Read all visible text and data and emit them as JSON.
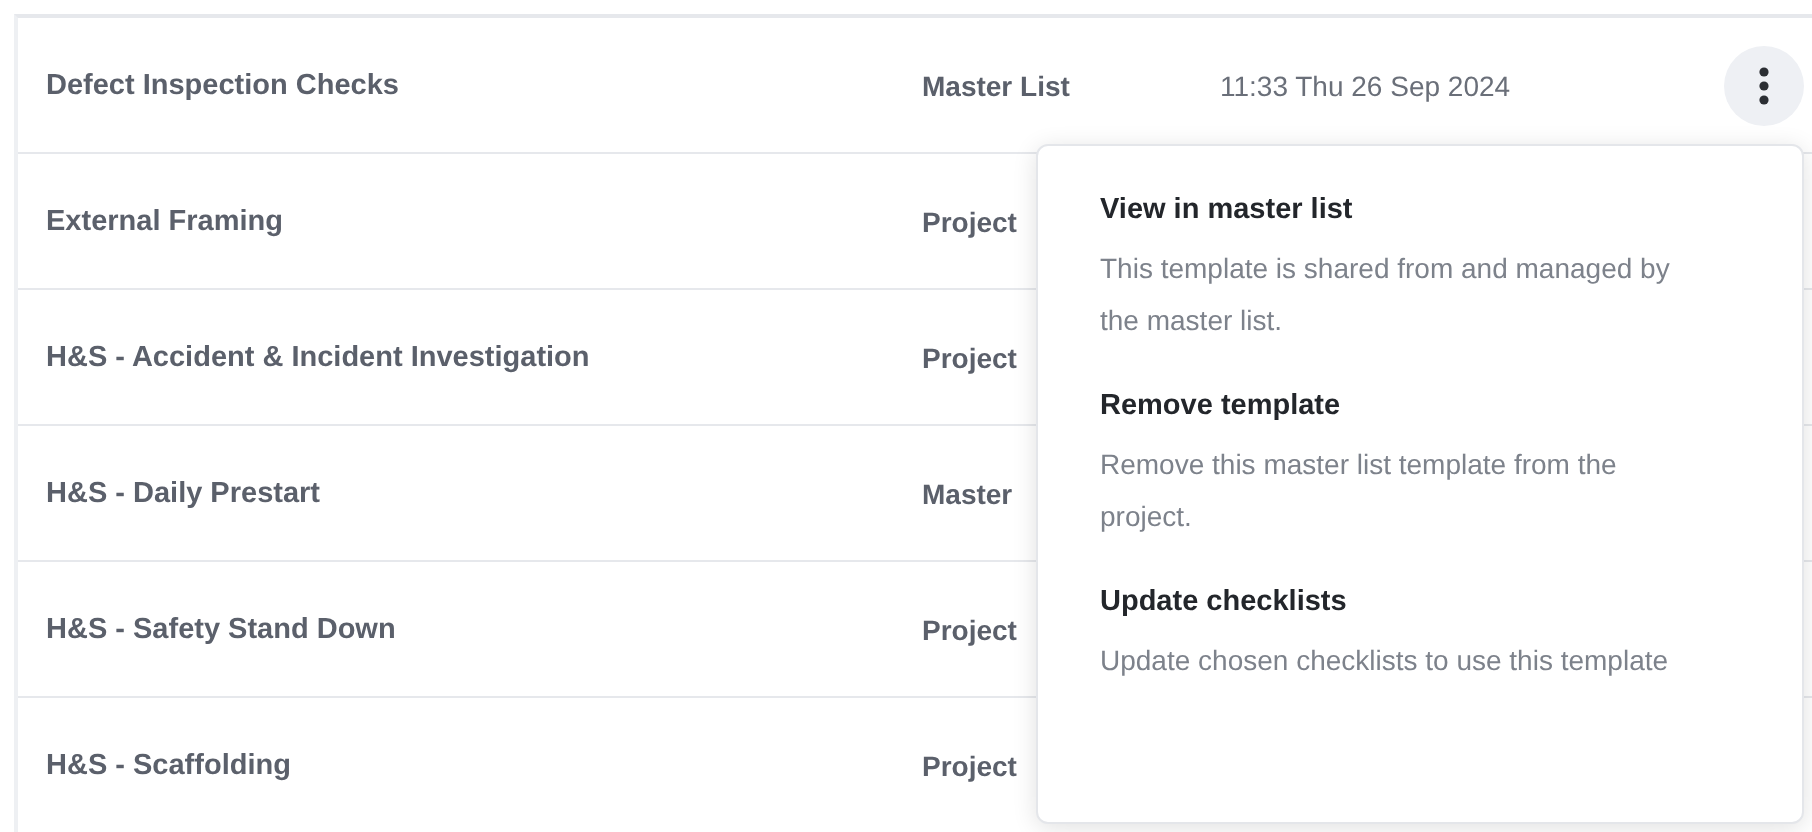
{
  "rows": [
    {
      "name": "Defect Inspection Checks",
      "type": "Master List",
      "updated": "11:33 Thu 26 Sep 2024",
      "menu_button": true
    },
    {
      "name": "External Framing",
      "type": "Project"
    },
    {
      "name": "H&S - Accident & Incident Investigation",
      "type": "Project"
    },
    {
      "name": "H&S - Daily Prestart",
      "type": "Master"
    },
    {
      "name": "H&S - Safety Stand Down",
      "type": "Project"
    },
    {
      "name": "H&S - Scaffolding",
      "type": "Project"
    }
  ],
  "menu": {
    "items": [
      {
        "title": "View in master list",
        "description": "This template is shared from and managed by the master list."
      },
      {
        "title": "Remove template",
        "description": "Remove this master list template from the project."
      },
      {
        "title": "Update checklists",
        "description": "Update chosen checklists to use this template"
      }
    ]
  }
}
